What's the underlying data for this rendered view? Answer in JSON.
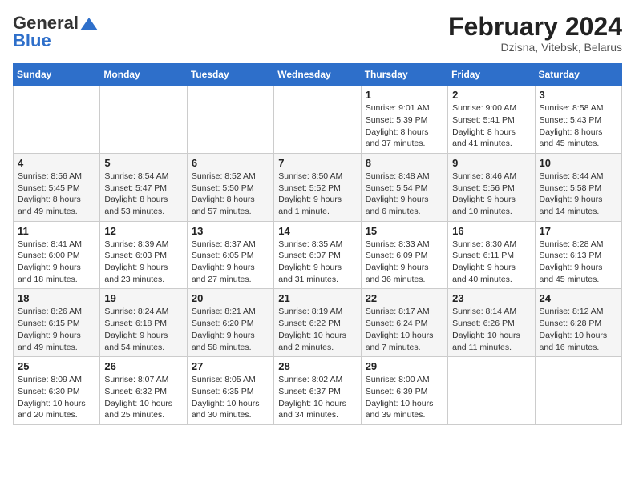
{
  "header": {
    "logo_line1": "General",
    "logo_line2": "Blue",
    "title": "February 2024",
    "subtitle": "Dzisna, Vitebsk, Belarus"
  },
  "days_of_week": [
    "Sunday",
    "Monday",
    "Tuesday",
    "Wednesday",
    "Thursday",
    "Friday",
    "Saturday"
  ],
  "weeks": [
    [
      {
        "day": "",
        "info": ""
      },
      {
        "day": "",
        "info": ""
      },
      {
        "day": "",
        "info": ""
      },
      {
        "day": "",
        "info": ""
      },
      {
        "day": "1",
        "info": "Sunrise: 9:01 AM\nSunset: 5:39 PM\nDaylight: 8 hours\nand 37 minutes."
      },
      {
        "day": "2",
        "info": "Sunrise: 9:00 AM\nSunset: 5:41 PM\nDaylight: 8 hours\nand 41 minutes."
      },
      {
        "day": "3",
        "info": "Sunrise: 8:58 AM\nSunset: 5:43 PM\nDaylight: 8 hours\nand 45 minutes."
      }
    ],
    [
      {
        "day": "4",
        "info": "Sunrise: 8:56 AM\nSunset: 5:45 PM\nDaylight: 8 hours\nand 49 minutes."
      },
      {
        "day": "5",
        "info": "Sunrise: 8:54 AM\nSunset: 5:47 PM\nDaylight: 8 hours\nand 53 minutes."
      },
      {
        "day": "6",
        "info": "Sunrise: 8:52 AM\nSunset: 5:50 PM\nDaylight: 8 hours\nand 57 minutes."
      },
      {
        "day": "7",
        "info": "Sunrise: 8:50 AM\nSunset: 5:52 PM\nDaylight: 9 hours\nand 1 minute."
      },
      {
        "day": "8",
        "info": "Sunrise: 8:48 AM\nSunset: 5:54 PM\nDaylight: 9 hours\nand 6 minutes."
      },
      {
        "day": "9",
        "info": "Sunrise: 8:46 AM\nSunset: 5:56 PM\nDaylight: 9 hours\nand 10 minutes."
      },
      {
        "day": "10",
        "info": "Sunrise: 8:44 AM\nSunset: 5:58 PM\nDaylight: 9 hours\nand 14 minutes."
      }
    ],
    [
      {
        "day": "11",
        "info": "Sunrise: 8:41 AM\nSunset: 6:00 PM\nDaylight: 9 hours\nand 18 minutes."
      },
      {
        "day": "12",
        "info": "Sunrise: 8:39 AM\nSunset: 6:03 PM\nDaylight: 9 hours\nand 23 minutes."
      },
      {
        "day": "13",
        "info": "Sunrise: 8:37 AM\nSunset: 6:05 PM\nDaylight: 9 hours\nand 27 minutes."
      },
      {
        "day": "14",
        "info": "Sunrise: 8:35 AM\nSunset: 6:07 PM\nDaylight: 9 hours\nand 31 minutes."
      },
      {
        "day": "15",
        "info": "Sunrise: 8:33 AM\nSunset: 6:09 PM\nDaylight: 9 hours\nand 36 minutes."
      },
      {
        "day": "16",
        "info": "Sunrise: 8:30 AM\nSunset: 6:11 PM\nDaylight: 9 hours\nand 40 minutes."
      },
      {
        "day": "17",
        "info": "Sunrise: 8:28 AM\nSunset: 6:13 PM\nDaylight: 9 hours\nand 45 minutes."
      }
    ],
    [
      {
        "day": "18",
        "info": "Sunrise: 8:26 AM\nSunset: 6:15 PM\nDaylight: 9 hours\nand 49 minutes."
      },
      {
        "day": "19",
        "info": "Sunrise: 8:24 AM\nSunset: 6:18 PM\nDaylight: 9 hours\nand 54 minutes."
      },
      {
        "day": "20",
        "info": "Sunrise: 8:21 AM\nSunset: 6:20 PM\nDaylight: 9 hours\nand 58 minutes."
      },
      {
        "day": "21",
        "info": "Sunrise: 8:19 AM\nSunset: 6:22 PM\nDaylight: 10 hours\nand 2 minutes."
      },
      {
        "day": "22",
        "info": "Sunrise: 8:17 AM\nSunset: 6:24 PM\nDaylight: 10 hours\nand 7 minutes."
      },
      {
        "day": "23",
        "info": "Sunrise: 8:14 AM\nSunset: 6:26 PM\nDaylight: 10 hours\nand 11 minutes."
      },
      {
        "day": "24",
        "info": "Sunrise: 8:12 AM\nSunset: 6:28 PM\nDaylight: 10 hours\nand 16 minutes."
      }
    ],
    [
      {
        "day": "25",
        "info": "Sunrise: 8:09 AM\nSunset: 6:30 PM\nDaylight: 10 hours\nand 20 minutes."
      },
      {
        "day": "26",
        "info": "Sunrise: 8:07 AM\nSunset: 6:32 PM\nDaylight: 10 hours\nand 25 minutes."
      },
      {
        "day": "27",
        "info": "Sunrise: 8:05 AM\nSunset: 6:35 PM\nDaylight: 10 hours\nand 30 minutes."
      },
      {
        "day": "28",
        "info": "Sunrise: 8:02 AM\nSunset: 6:37 PM\nDaylight: 10 hours\nand 34 minutes."
      },
      {
        "day": "29",
        "info": "Sunrise: 8:00 AM\nSunset: 6:39 PM\nDaylight: 10 hours\nand 39 minutes."
      },
      {
        "day": "",
        "info": ""
      },
      {
        "day": "",
        "info": ""
      }
    ]
  ]
}
